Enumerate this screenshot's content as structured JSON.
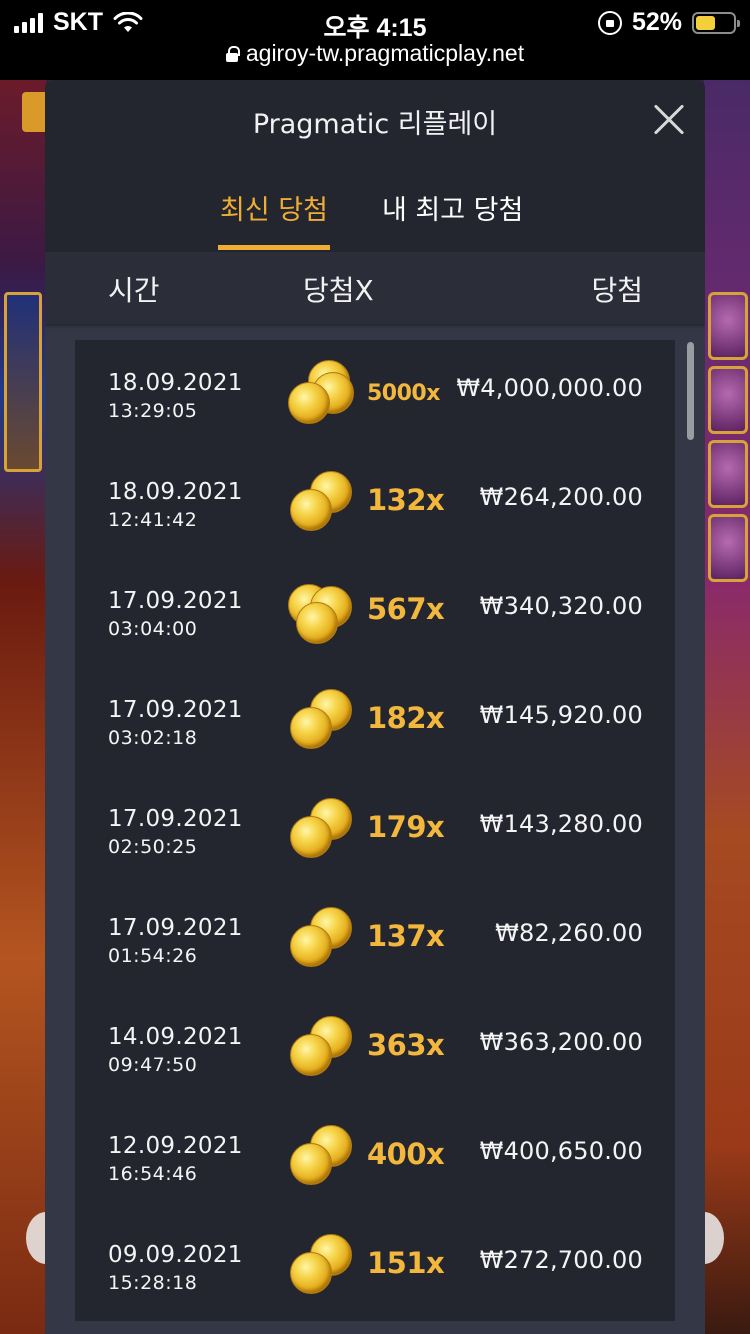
{
  "status_bar": {
    "carrier": "SKT",
    "time": "오후 4:15",
    "battery_percent": "52%",
    "battery_level": 0.52,
    "url": "agiroy-tw.pragmaticplay.net"
  },
  "modal": {
    "title": "Pragmatic 리플레이",
    "tabs": [
      {
        "label": "최신 당첨",
        "active": true
      },
      {
        "label": "내 최고 당첨",
        "active": false
      }
    ],
    "columns": {
      "time": "시간",
      "multiplier": "당첨X",
      "win": "당첨"
    },
    "rows": [
      {
        "date": "18.09.2021",
        "time": "13:29:05",
        "multiplier": "5000x",
        "amount": "₩4,000,000.00",
        "coin_icon": "coin-stack-icon"
      },
      {
        "date": "18.09.2021",
        "time": "12:41:42",
        "multiplier": "132x",
        "amount": "₩264,200.00",
        "coin_icon": "coins-icon"
      },
      {
        "date": "17.09.2021",
        "time": "03:04:00",
        "multiplier": "567x",
        "amount": "₩340,320.00",
        "coin_icon": "coins-icon"
      },
      {
        "date": "17.09.2021",
        "time": "03:02:18",
        "multiplier": "182x",
        "amount": "₩145,920.00",
        "coin_icon": "coins-icon"
      },
      {
        "date": "17.09.2021",
        "time": "02:50:25",
        "multiplier": "179x",
        "amount": "₩143,280.00",
        "coin_icon": "coins-icon"
      },
      {
        "date": "17.09.2021",
        "time": "01:54:26",
        "multiplier": "137x",
        "amount": "₩82,260.00",
        "coin_icon": "coins-icon"
      },
      {
        "date": "14.09.2021",
        "time": "09:47:50",
        "multiplier": "363x",
        "amount": "₩363,200.00",
        "coin_icon": "coins-icon"
      },
      {
        "date": "12.09.2021",
        "time": "16:54:46",
        "multiplier": "400x",
        "amount": "₩400,650.00",
        "coin_icon": "coins-icon"
      },
      {
        "date": "09.09.2021",
        "time": "15:28:18",
        "multiplier": "151x",
        "amount": "₩272,700.00",
        "coin_icon": "coins-icon"
      }
    ]
  },
  "colors": {
    "accent": "#f0ad33",
    "multiplier": "#f2b73c",
    "modal_bg": "#343846",
    "row_bg": "#23262f"
  }
}
